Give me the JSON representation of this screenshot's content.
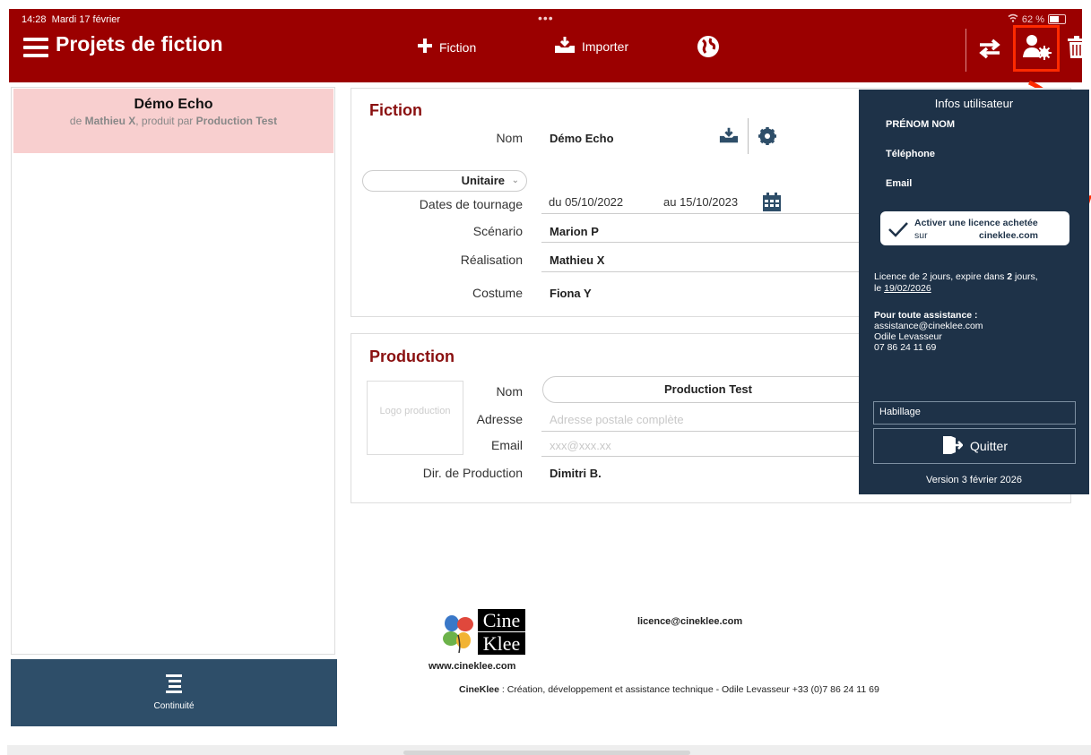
{
  "status": {
    "time": "14:28",
    "date": "Mardi 17 février",
    "dots": "•••",
    "battery": "62 %"
  },
  "header": {
    "title": "Projets de fiction",
    "add_fiction_label": "Fiction",
    "import_label": "Importer",
    "icons": [
      "menu-icon",
      "plus-icon",
      "import-icon",
      "globe-icon",
      "swap-icon",
      "user-settings-icon",
      "trash-icon"
    ],
    "colors": {
      "bar": "#9b0000",
      "highlight": "#ff2a00"
    }
  },
  "sidebar": {
    "project": {
      "title": "Démo Echo",
      "by_prefix": "de",
      "author": "Mathieu X",
      "mid": ", produit par",
      "producer": "Production Test"
    },
    "continuite_label": "Continuité"
  },
  "fiction": {
    "title": "Fiction",
    "nom_label": "Nom",
    "nom_value": "Démo Echo",
    "type_value": "Unitaire",
    "dates_label": "Dates de tournage",
    "date_from": "du 05/10/2022",
    "date_to": "au 15/10/2023",
    "rows": [
      {
        "label": "Scénario",
        "value": "Marion P"
      },
      {
        "label": "Réalisation",
        "value": "Mathieu X"
      },
      {
        "label": "Costume",
        "value": "Fiona Y"
      }
    ]
  },
  "production": {
    "title": "Production",
    "logo_placeholder": "Logo production",
    "nom_label": "Nom",
    "nom_value": "Production Test",
    "adresse_label": "Adresse",
    "adresse_placeholder": "Adresse postale complète",
    "email_label": "Email",
    "email_placeholder": "xxx@xxx.xx",
    "dir_label": "Dir. de Production",
    "dir_value": "Dimitri B."
  },
  "user_panel": {
    "title": "Infos utilisateur",
    "name": "PRÉNOM NOM",
    "phone_label": "Téléphone",
    "email_label": "Email",
    "license_btn_line1": "Activer une licence achetée",
    "license_btn_sur": "sur",
    "license_btn_site": "cineklee.com",
    "license_info_pre": "Licence de 2 jours, expire dans ",
    "license_info_days": "2",
    "license_info_post": " jours,",
    "license_info_le": "le",
    "license_date": "19/02/2026",
    "support_title": "Pour toute assistance :",
    "support_email": "assistance@cineklee.com",
    "support_name": "Odile Levasseur",
    "support_phone": "07 86 24 11 69",
    "habillage_value": "Habillage",
    "quit_label": "Quitter",
    "version": "Version  3 février 2026",
    "bg_color": "#1e3248"
  },
  "footer": {
    "logo_word1": "Cine",
    "logo_word2": "Klee",
    "site": "www.cineklee.com",
    "licence_email": "licence@cineklee.com",
    "credit_brand": "CineKlee",
    "credit_text": " : Création, développement et assistance technique - Odile Levasseur +33 (0)7 86 24 11 69"
  }
}
